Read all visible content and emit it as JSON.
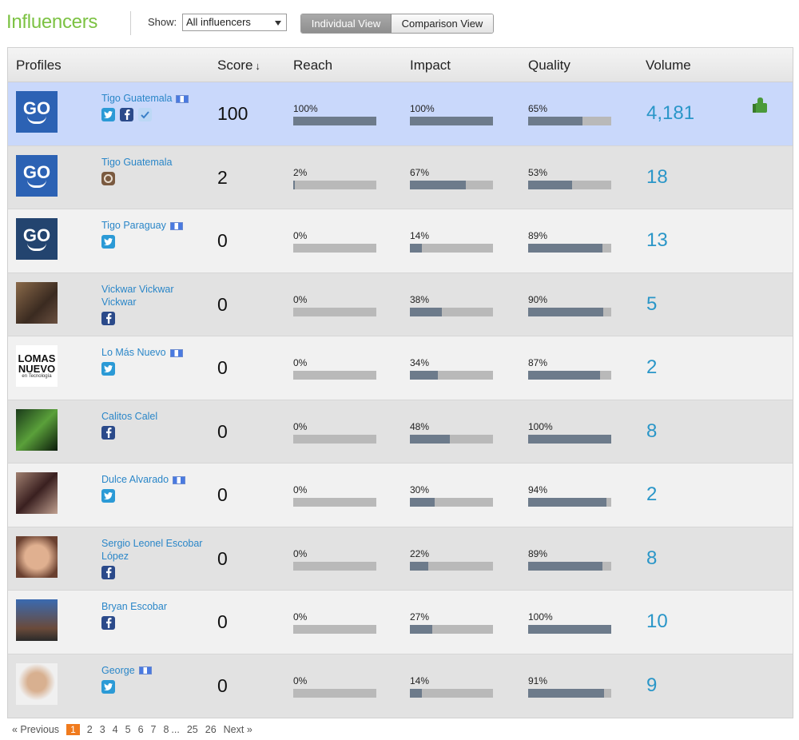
{
  "header": {
    "title": "Influencers",
    "show_label": "Show:",
    "filter_value": "All influencers",
    "view_individual": "Individual View",
    "view_comparison": "Comparison View"
  },
  "columns": {
    "profiles": "Profiles",
    "score": "Score",
    "score_sort_icon": "↓",
    "reach": "Reach",
    "impact": "Impact",
    "quality": "Quality",
    "volume": "Volume"
  },
  "rows": [
    {
      "name": "Tigo Guatemala",
      "flag": true,
      "avatar": "go",
      "networks": [
        "twitter",
        "facebook",
        "foursquare"
      ],
      "score": "100",
      "reach": "100%",
      "reach_v": 100,
      "impact": "100%",
      "impact_v": 100,
      "quality": "65%",
      "quality_v": 65,
      "volume": "4,181"
    },
    {
      "name": "Tigo Guatemala",
      "flag": false,
      "avatar": "go",
      "networks": [
        "instagram"
      ],
      "score": "2",
      "reach": "2%",
      "reach_v": 2,
      "impact": "67%",
      "impact_v": 67,
      "quality": "53%",
      "quality_v": 53,
      "volume": "18"
    },
    {
      "name": "Tigo Paraguay",
      "flag": true,
      "avatar": "go-dark",
      "networks": [
        "twitter"
      ],
      "score": "0",
      "reach": "0%",
      "reach_v": 0,
      "impact": "14%",
      "impact_v": 14,
      "quality": "89%",
      "quality_v": 89,
      "volume": "13"
    },
    {
      "name": "Vickwar Vickwar Vickwar",
      "flag": false,
      "avatar": "photo",
      "networks": [
        "facebook"
      ],
      "score": "0",
      "reach": "0%",
      "reach_v": 0,
      "impact": "38%",
      "impact_v": 38,
      "quality": "90%",
      "quality_v": 90,
      "volume": "5"
    },
    {
      "name": "Lo Más Nuevo",
      "flag": true,
      "avatar": "lomas",
      "networks": [
        "twitter"
      ],
      "score": "0",
      "reach": "0%",
      "reach_v": 0,
      "impact": "34%",
      "impact_v": 34,
      "quality": "87%",
      "quality_v": 87,
      "volume": "2"
    },
    {
      "name": "Calitos Calel",
      "flag": false,
      "avatar": "photo-2",
      "networks": [
        "facebook"
      ],
      "score": "0",
      "reach": "0%",
      "reach_v": 0,
      "impact": "48%",
      "impact_v": 48,
      "quality": "100%",
      "quality_v": 100,
      "volume": "8"
    },
    {
      "name": "Dulce Alvarado",
      "flag": true,
      "avatar": "photo-3",
      "networks": [
        "twitter"
      ],
      "score": "0",
      "reach": "0%",
      "reach_v": 0,
      "impact": "30%",
      "impact_v": 30,
      "quality": "94%",
      "quality_v": 94,
      "volume": "2"
    },
    {
      "name": "Sergio Leonel Escobar López",
      "flag": false,
      "avatar": "photo-4",
      "networks": [
        "facebook"
      ],
      "score": "0",
      "reach": "0%",
      "reach_v": 0,
      "impact": "22%",
      "impact_v": 22,
      "quality": "89%",
      "quality_v": 89,
      "volume": "8"
    },
    {
      "name": "Bryan Escobar",
      "flag": false,
      "avatar": "photo-5",
      "networks": [
        "facebook"
      ],
      "score": "0",
      "reach": "0%",
      "reach_v": 0,
      "impact": "27%",
      "impact_v": 27,
      "quality": "100%",
      "quality_v": 100,
      "volume": "10"
    },
    {
      "name": "George",
      "flag": true,
      "avatar": "photo-6",
      "networks": [
        "twitter"
      ],
      "score": "0",
      "reach": "0%",
      "reach_v": 0,
      "impact": "14%",
      "impact_v": 14,
      "quality": "91%",
      "quality_v": 91,
      "volume": "9"
    }
  ],
  "avatar_text": {
    "go": "GO",
    "lomas_1": "LOMAS",
    "lomas_2": "NUEVO",
    "lomas_3": "en Tecnología"
  },
  "pagination": {
    "prev": "« Previous",
    "current": "1",
    "pages": [
      "2",
      "3",
      "4",
      "5",
      "6",
      "7",
      "8"
    ],
    "ellipsis": "...",
    "tail": [
      "25",
      "26"
    ],
    "next": "Next »"
  },
  "colors": {
    "title": "#7cc243",
    "selected_row": "#c9d8fb",
    "link": "#2a86c8",
    "volume": "#2a96c8",
    "bar_fill": "#6d7b8b",
    "bar_track": "#b9b9b9",
    "page_current": "#f07b1e"
  }
}
